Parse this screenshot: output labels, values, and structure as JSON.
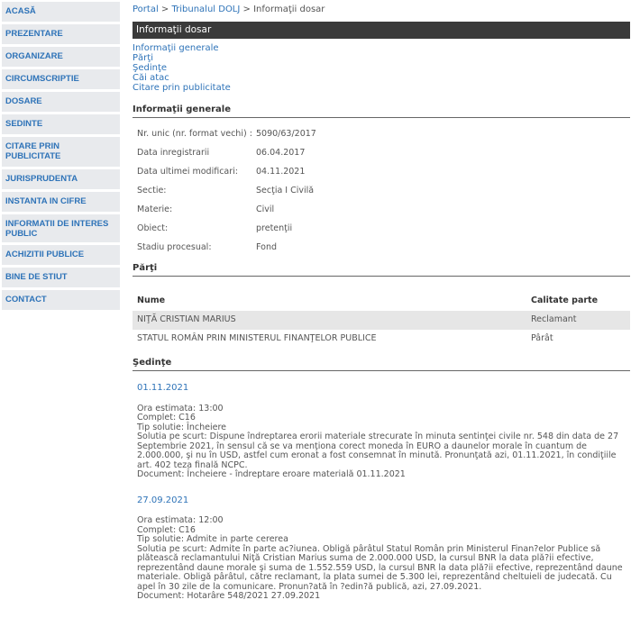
{
  "sidebar": {
    "items": [
      "ACASĂ",
      "PREZENTARE",
      "ORGANIZARE",
      "CIRCUMSCRIPTIE",
      "DOSARE",
      "SEDINTE",
      "CITARE PRIN PUBLICITATE",
      "JURISPRUDENTA",
      "INSTANTA IN CIFRE",
      "INFORMATII DE INTERES PUBLIC",
      "ACHIZITII PUBLICE",
      "BINE DE STIUT",
      "CONTACT"
    ]
  },
  "breadcrumb": {
    "portal": "Portal",
    "sep1": " > ",
    "tribunal": "Tribunalul DOLJ",
    "sep2": " > ",
    "current": "Informaţii dosar"
  },
  "page_title": "Informaţii dosar",
  "toc": [
    "Informaţii generale",
    "Părţi",
    "Şedinţe",
    "Căi atac",
    "Citare prin publicitate"
  ],
  "general": {
    "heading": "Informaţii generale",
    "rows": [
      {
        "k": "Nr. unic (nr. format vechi) :",
        "v": "5090/63/2017"
      },
      {
        "k": "Data inregistrarii",
        "v": "06.04.2017"
      },
      {
        "k": "Data ultimei modificari:",
        "v": "04.11.2021"
      },
      {
        "k": "Sectie:",
        "v": "Secţia I Civilă"
      },
      {
        "k": "Materie:",
        "v": "Civil"
      },
      {
        "k": "Obiect:",
        "v": "pretenţii"
      },
      {
        "k": "Stadiu procesual:",
        "v": "Fond"
      }
    ]
  },
  "parti": {
    "heading": "Părţi",
    "col_name": "Nume",
    "col_role": "Calitate parte",
    "rows": [
      {
        "name": "NIŢĂ CRISTIAN MARIUS",
        "role": "Reclamant"
      },
      {
        "name": "STATUL ROMÂN PRIN MINISTERUL FINANŢELOR PUBLICE",
        "role": "Pârât"
      }
    ]
  },
  "sedinte": {
    "heading": "Şedinţe",
    "items": [
      {
        "date": "01.11.2021",
        "lines": [
          "Ora estimata: 13:00",
          "Complet: C16",
          "Tip solutie: Încheiere",
          "Solutia pe scurt: Dispune îndreptarea erorii materiale strecurate în minuta sentinţei civile nr. 548 din data de 27 Septembrie 2021, în sensul că se va menţiona corect moneda în EURO a daunelor morale în cuantum de 2.000.000, şi nu în USD, astfel cum eronat a fost consemnat în minută. Pronunţată azi, 01.11.2021, în condiţiile art. 402 teza finală NCPC.",
          "Document: Încheiere - îndreptare eroare materială    01.11.2021"
        ]
      },
      {
        "date": "27.09.2021",
        "lines": [
          "Ora estimata: 12:00",
          "Complet: C16",
          "Tip solutie: Admite in parte cererea",
          "Solutia pe scurt: Admite în parte ac?iunea. Obligă pârâtul Statul Român prin Ministerul Finan?elor Publice să plătească reclamantului Niţă Cristian Marius suma de 2.000.000 USD, la cursul BNR la data plă?ii efective, reprezentând daune morale şi suma de 1.552.559 USD, la cursul BNR la data plă?ii efective, reprezentând daune materiale. Obligă pârâtul, către reclamant, la plata sumei de 5.300 lei, reprezentând cheltuieli de judecată. Cu apel în 30 zile de la comunicare. Pronun?ată în ?edin?ă publică, azi, 27.09.2021.",
          "Document: Hotarâre  548/2021  27.09.2021"
        ]
      }
    ]
  }
}
